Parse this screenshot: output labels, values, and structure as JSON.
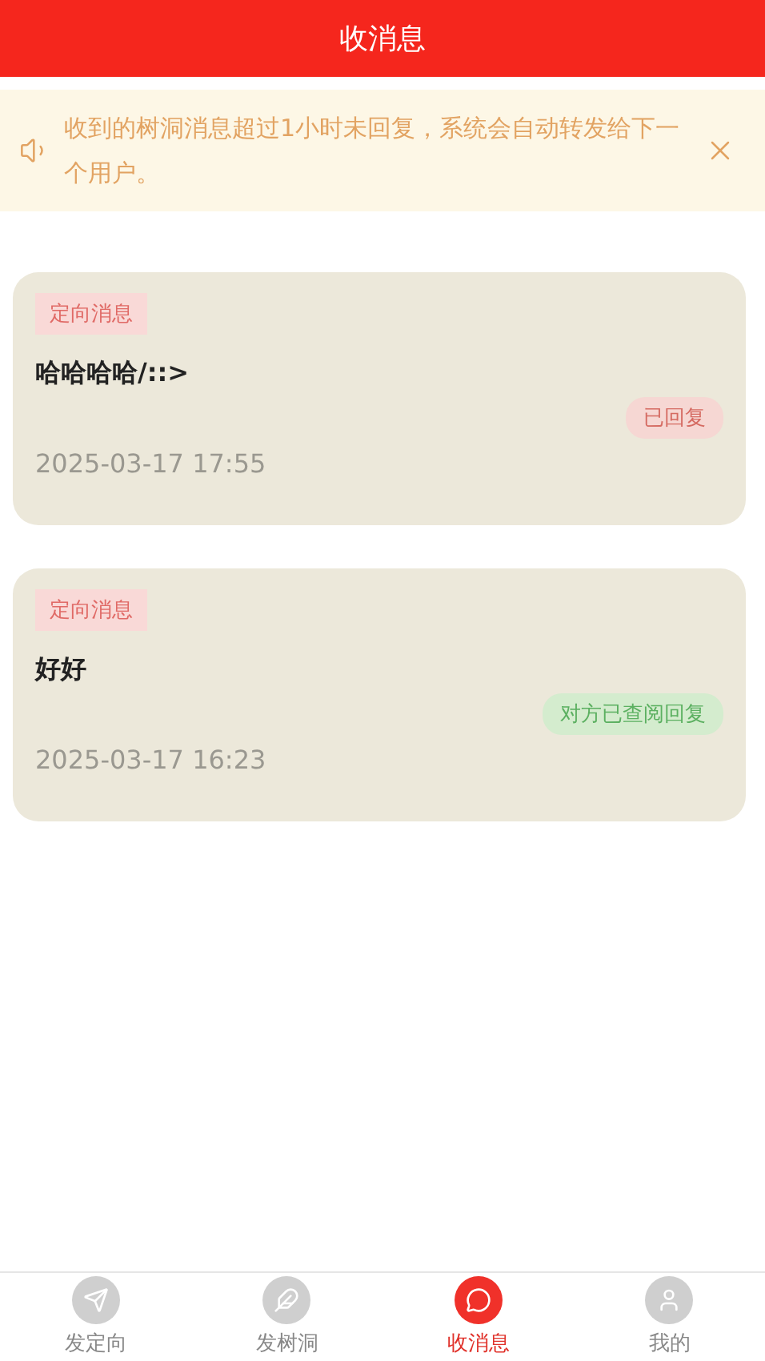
{
  "header": {
    "title": "收消息"
  },
  "notice": {
    "text": "收到的树洞消息超过1小时未回复，系统会自动转发给下一个用户。"
  },
  "messages": [
    {
      "tag": "定向消息",
      "content": "哈哈哈哈/::>",
      "status": {
        "kind": "replied",
        "label": "已回复"
      },
      "time": "2025-03-17 17:55"
    },
    {
      "tag": "定向消息",
      "content": "好好",
      "status": {
        "kind": "read",
        "label": "对方已查阅回复"
      },
      "time": "2025-03-17 16:23"
    }
  ],
  "tab_bar": [
    {
      "label": "发定向",
      "kind": "send",
      "selected": false
    },
    {
      "label": "发树洞",
      "kind": "leaf",
      "selected": false
    },
    {
      "label": "收消息",
      "kind": "message",
      "selected": true
    },
    {
      "label": "我的",
      "kind": "user",
      "selected": false
    }
  ]
}
